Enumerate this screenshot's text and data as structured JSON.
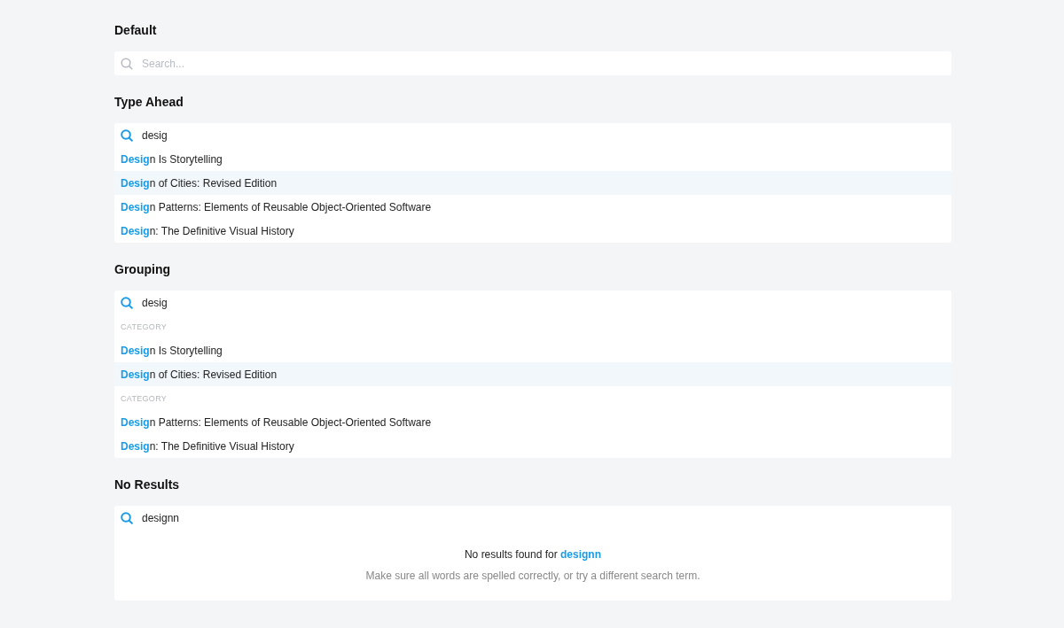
{
  "sections": [
    {
      "kind": "default",
      "title": "Default",
      "search": {
        "placeholder": "Search..."
      }
    },
    {
      "kind": "typeahead",
      "title": "Type Ahead",
      "search": {
        "value": "desig"
      },
      "items": [
        {
          "kind": "result",
          "text": "**Desig**n Is Storytelling",
          "selected": false
        },
        {
          "kind": "result",
          "text": "**Desig**n of Cities: Revised Edition",
          "selected": true
        },
        {
          "kind": "result",
          "text": "**Desig**n Patterns: Elements of Reusable Object-Oriented Software",
          "selected": false
        },
        {
          "kind": "result",
          "text": "**Desig**n: The Definitive Visual History",
          "selected": false
        }
      ]
    },
    {
      "kind": "grouping",
      "title": "Grouping",
      "search": {
        "value": "desig"
      },
      "items": [
        {
          "kind": "category",
          "text": "CATEGORY"
        },
        {
          "kind": "result",
          "text": "**Desig**n Is Storytelling",
          "selected": false
        },
        {
          "kind": "result",
          "text": "**Desig**n of Cities: Revised Edition",
          "selected": true
        },
        {
          "kind": "category",
          "text": "CATEGORY"
        },
        {
          "kind": "result",
          "text": "**Desig**n Patterns: Elements of Reusable Object-Oriented Software",
          "selected": false
        },
        {
          "kind": "result",
          "text": "**Desig**n: The Definitive Visual History",
          "selected": false
        }
      ]
    },
    {
      "kind": "no_results",
      "title": "No Results",
      "search": {
        "value": "designn"
      },
      "message": "No results found for **designn**",
      "hint": "Make sure all words are spelled correctly, or try a different search term."
    }
  ]
}
